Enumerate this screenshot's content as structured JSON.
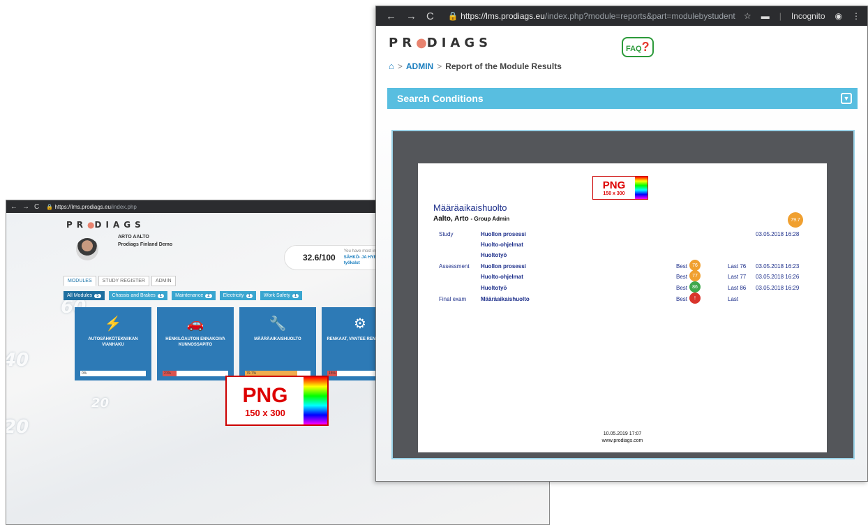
{
  "back_window": {
    "url_domain": "https://lms.prodiags.eu",
    "url_rest": "/index.php",
    "logo": {
      "left": "PR",
      "dot": "●",
      "right": "DIAGS"
    },
    "user": {
      "name": "ARTO AALTO",
      "org": "Prodiags Finland Demo"
    },
    "score": "32.6/100",
    "score_note": "You have most im",
    "score_link": "SÄHKÖ- JA HYBR",
    "score_link2": "työkalut",
    "tabs": [
      "MODULES",
      "STUDY REGISTER",
      "ADMIN"
    ],
    "filters": [
      {
        "label": "All Modules",
        "count": "5"
      },
      {
        "label": "Chassis and Brakes",
        "count": "1"
      },
      {
        "label": "Maintenance",
        "count": "2"
      },
      {
        "label": "Electricity",
        "count": "1"
      },
      {
        "label": "Work Safety",
        "count": "1"
      }
    ],
    "cards": [
      {
        "title": "AUTOSÄHKÖTEKNIIKAN VIANHAKU",
        "progress": "0%",
        "value": 0
      },
      {
        "title": "HENKILÖAUTON ENNAKOIVA KUNNOSSAPITO",
        "progress": "21%",
        "value": 21
      },
      {
        "title": "MÄÄRÄAIKAISHUOLTO",
        "progress": "79.7%",
        "value": 79.7
      },
      {
        "title": "RENKAAT, VANTEE RENGASTYÖ",
        "progress": "15%",
        "value": 15
      }
    ],
    "png_placeholder": {
      "big": "PNG",
      "small": "150 x 300"
    },
    "gauge_numbers": [
      "60",
      "40",
      "20",
      "20"
    ]
  },
  "front_window": {
    "url_domain": "https://lms.prodiags.eu",
    "url_rest": "/index.php?module=reports&part=modulebystudent",
    "incognito_label": "Incognito",
    "logo": {
      "left": "PR",
      "dot": "●",
      "right": "DIAGS"
    },
    "faq": {
      "text": "FAQ",
      "q": "?"
    },
    "breadcrumb": {
      "sep": ">",
      "admin": "ADMIN",
      "current": "Report of the Module Results"
    },
    "search_conditions": "Search Conditions",
    "report": {
      "png_placeholder": {
        "big": "PNG",
        "small": "150 x 300"
      },
      "module_title": "Määräaikaishuolto",
      "student": "Aalto, Arto",
      "role": "- Group Admin",
      "total_score": "79.7",
      "study_label": "Study",
      "study_items": [
        "Huollon prosessi",
        "Huolto-ohjelmat",
        "Huoltotyö"
      ],
      "study_date": "03.05.2018 16:28",
      "assessment_label": "Assessment",
      "assessments": [
        {
          "name": "Huollon prosessi",
          "best_label": "Best",
          "best": "76",
          "last": "Last 76",
          "date": "03.05.2018 16:23"
        },
        {
          "name": "Huolto-ohjelmat",
          "best_label": "Best",
          "best": "77",
          "last": "Last 77",
          "date": "03.05.2018 16:26"
        },
        {
          "name": "Huoltotyö",
          "best_label": "Best",
          "best": "86",
          "last": "Last 86",
          "date": "03.05.2018 16:29"
        }
      ],
      "final_label": "Final exam",
      "final": {
        "name": "Määräaikaishuolto",
        "best_label": "Best",
        "best": "!",
        "last": "Last"
      },
      "footer_date": "10.05.2019 17:07",
      "footer_site": "www.prodiags.com"
    }
  },
  "colors": {
    "accent": "#58bee0",
    "brand_blue": "#1c7fbf",
    "orange": "#f0a030",
    "green": "#3fa84c",
    "red": "#d9342b"
  }
}
